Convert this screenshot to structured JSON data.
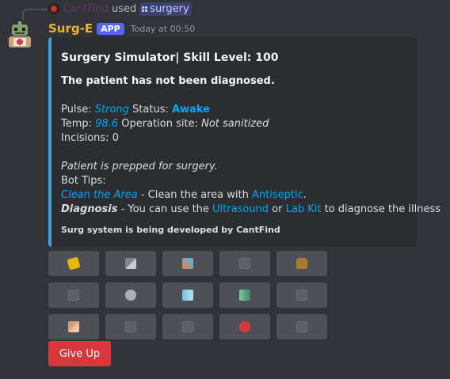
{
  "reply": {
    "replied_user": "CantFind",
    "used_text": "used",
    "command": "surgery"
  },
  "message": {
    "username": "Surg-E",
    "app_tag": "APP",
    "timestamp": "Today at 00:50"
  },
  "embed": {
    "title": "Surgery Simulator| Skill Level: 100",
    "diagnosis_status": "The patient has not been diagnosed.",
    "pulse_label": "Pulse:",
    "pulse_value": "Strong",
    "status_label": "Status:",
    "status_value": "Awake",
    "temp_label": "Temp:",
    "temp_value": "98.6",
    "op_site_label": "Operation site:",
    "op_site_value": "Not sanitized",
    "incisions": "Incisions: 0",
    "prepped": "Patient is prepped for surgery.",
    "bot_tips": "Bot Tips:",
    "tip1_link": "Clean the Area",
    "tip1_text": " - Clean the area with ",
    "tip1_item": "Antiseptic",
    "tip1_end": ".",
    "tip2_bold": "Diagnosis",
    "tip2_text": " - You can use the ",
    "tip2_item1": "Ultrasound",
    "tip2_or": " or ",
    "tip2_item2": "Lab Kit",
    "tip2_end": " to diagnose the illness",
    "footer": "Surg system is being developed by CantFind",
    "accent_color": "#3e9fd9"
  },
  "tool_buttons": [
    {
      "icon": "antiseptic-sponge-icon"
    },
    {
      "icon": "scalpel-icon"
    },
    {
      "icon": "scissors-icon"
    },
    {
      "icon": "blank-slot-icon"
    },
    {
      "icon": "bag-icon"
    },
    {
      "icon": "blank-slot-icon"
    },
    {
      "icon": "gauze-icon"
    },
    {
      "icon": "ultrasound-icon"
    },
    {
      "icon": "lab-kit-icon"
    },
    {
      "icon": "blank-slot-icon"
    },
    {
      "icon": "bandage-icon"
    },
    {
      "icon": "blank-slot-icon"
    },
    {
      "icon": "blank-slot-icon"
    },
    {
      "icon": "pill-icon"
    },
    {
      "icon": "blank-slot-icon"
    }
  ],
  "give_up_label": "Give Up",
  "colors": {
    "background": "#313338",
    "embed_bg": "#2b2d31",
    "link": "#00a8fc",
    "username": "#f0b232",
    "danger": "#da373c"
  }
}
